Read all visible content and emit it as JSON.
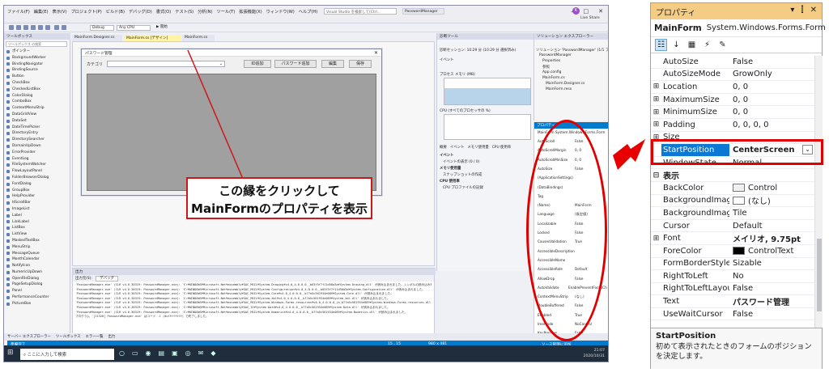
{
  "vs": {
    "menu": [
      "ファイル(F)",
      "編集(E)",
      "表示(V)",
      "プロジェクト(P)",
      "ビルド(B)",
      "デバッグ(D)",
      "書式(O)",
      "テスト(S)",
      "分析(N)",
      "ツール(T)",
      "拡張機能(X)",
      "ウィンドウ(W)",
      "ヘルプ(H)"
    ],
    "search_placeholder": "Visual Studio を検索して(Ctrl...",
    "project_name": "PasswordManager",
    "live_share": "Live Share",
    "toolbar_debug": "Debug",
    "toolbar_cpu": "Any CPU",
    "toolbar_start": "開始",
    "toolbox_title": "ツールボックス",
    "toolbox_search": "ツールボックス の検索",
    "toolbox_items": [
      "ポインター",
      "BackgroundWorker",
      "BindingNavigator",
      "BindingSource",
      "Button",
      "CheckBox",
      "CheckedListBox",
      "ColorDialog",
      "ComboBox",
      "ContextMenuStrip",
      "DataGridView",
      "DataSet",
      "DateTimePicker",
      "DirectoryEntry",
      "DirectorySearcher",
      "DomainUpDown",
      "ErrorProvider",
      "EventLog",
      "FileSystemWatcher",
      "FlowLayoutPanel",
      "FolderBrowserDialog",
      "FontDialog",
      "GroupBox",
      "HelpProvider",
      "HScrollBar",
      "ImageList",
      "Label",
      "LinkLabel",
      "ListBox",
      "ListView",
      "MaskedTextBox",
      "MenuStrip",
      "MessageQueue",
      "MonthCalendar",
      "NotifyIcon",
      "NumericUpDown",
      "OpenFileDialog",
      "PageSetupDialog",
      "Panel",
      "PerformanceCounter",
      "PictureBox"
    ],
    "doc_tabs": [
      "MainForm.Designer.cs",
      "MainForm.cs [デザイン]",
      "MainForm.cs"
    ],
    "form": {
      "title": "パスワード管理",
      "category_label": "カテゴリ",
      "buttons": [
        "ID追加",
        "パスワード追加",
        "編集",
        "保存"
      ]
    },
    "output_title": "出力",
    "output_source_label": "出力元(S):",
    "output_source": "デバッグ",
    "output_lines": [
      "'PasswordManager.exe' (CLR v4.0.30319: PasswordManager.exe): 'C:¥WINDOWS¥Microsoft.Net¥assembly¥GAC_MSIL¥System.Drawing¥v4.0_4.0.0.0__b03f5f7f11d50a3a¥System.Drawing.dll' が読み込まれました。シンボルの読み込みをスキップしました。",
      "'PasswordManager.exe' (CLR v4.0.30319: PasswordManager.exe): 'C:¥WINDOWS¥Microsoft.Net¥assembly¥GAC_MSIL¥System.Configuration¥v4.0_4.0.0.0__b03f5f7f11d50a3a¥System.Configuration.dll' が読み込まれました。",
      "'PasswordManager.exe' (CLR v4.0.30319: PasswordManager.exe): 'C:¥WINDOWS¥Microsoft.Net¥assembly¥GAC_MSIL¥System.Core¥v4.0_4.0.0.0__b77a5c561934e089¥System.Core.dll' が読み込まれました。",
      "'PasswordManager.exe' (CLR v4.0.30319: PasswordManager.exe): 'C:¥WINDOWS¥Microsoft.Net¥assembly¥GAC_MSIL¥System.Xml¥v4.0_4.0.0.0__b77a5c561934e089¥System.Xml.dll' が読み込まれました。",
      "'PasswordManager.exe' (CLR v4.0.30319: PasswordManager.exe): 'C:¥WINDOWS¥Microsoft.Net¥assembly¥GAC_MSIL¥System.Windows.Forms.resources¥v4.0_4.0.0.0_ja_b77a5c561934e089¥System.Windows.Forms.resources.dll' が読み込まれました。",
      "'PasswordManager.exe' (CLR v4.0.30319: PasswordManager.exe): 'C:¥WINDOWS¥Microsoft.Net¥assembly¥GAC_32¥System.Data¥v4.0_4.0.0.0__b77a5c561934e089¥System.Data.dll' が読み込まれました。",
      "'PasswordManager.exe' (CLR v4.0.30319: PasswordManager.exe): 'C:¥WINDOWS¥Microsoft.Net¥assembly¥GAC_MSIL¥System.Numerics¥v4.0_4.0.0.0__b77a5c561934e089¥System.Numerics.dll' が読み込まれました。",
      "プログラム '[11320] PasswordManager.exe' はコード -1 (0xffffffff) で終了しました。"
    ],
    "diag_title": "診断ツール",
    "diag_session": "診断セッション: 10:29 分 (10:29 分 選択済み)",
    "diag_events": "イベント",
    "diag_memory": "プロセス メモリ (MB)",
    "diag_cpu": "CPU (すべてのプロセッサの %)",
    "diag_summary_tabs": [
      "概要",
      "イベント",
      "メモリ使用量",
      "CPU 使用率"
    ],
    "diag_summary_items": [
      "イベント",
      "イベントの表示 (0 / 0)",
      "メモリ使用量",
      "スナップショットの作成",
      "CPU 使用率",
      "CPU プロファイルの記録"
    ],
    "solution_title": "ソリューション エクスプローラー",
    "solution_items": [
      "ソリューション 'PasswordManager' (1/1 プロジェクト)",
      "PasswordManager",
      "Properties",
      "参照",
      "App.config",
      "MainForm.cs",
      "MainForm.Designer.cs",
      "MainForm.resx"
    ],
    "small_props_title": "プロパティ",
    "small_props_obj": "MainForm  System.Windows.Forms.Form",
    "small_props_rows": [
      [
        "AutoScroll",
        "False"
      ],
      [
        "AutoScrollMargin",
        "0, 0"
      ],
      [
        "AutoScrollMinSize",
        "0, 0"
      ],
      [
        "AutoSize",
        "False"
      ],
      [
        "(ApplicationSettings)",
        ""
      ],
      [
        "(DataBindings)",
        ""
      ],
      [
        "Tag",
        ""
      ],
      [
        "(Name)",
        "MainForm"
      ],
      [
        "Language",
        "(既定値)"
      ],
      [
        "Localizable",
        "False"
      ],
      [
        "Locked",
        "False"
      ],
      [
        "CausesValidation",
        "True"
      ],
      [
        "AccessibleDescription",
        ""
      ],
      [
        "AccessibleName",
        ""
      ],
      [
        "AccessibleRole",
        "Default"
      ],
      [
        "AllowDrop",
        "False"
      ],
      [
        "AutoValidate",
        "EnablePreventFocusChange"
      ],
      [
        "ContextMenuStrip",
        "(なし)"
      ],
      [
        "DoubleBuffered",
        "False"
      ],
      [
        "Enabled",
        "True"
      ],
      [
        "ImeMode",
        "NoControl"
      ],
      [
        "KeyPreview",
        "False"
      ],
      [
        "ImeMode",
        "NoControl"
      ]
    ],
    "bottom_tabs": [
      "サーバー エクスプローラー",
      "ツールボックス",
      "エラー一覧",
      "出力"
    ],
    "status_left": "準備完了",
    "status_pos": "15 , 15",
    "status_size": "980 x 481",
    "status_right": "ソース管理に追加",
    "taskbar_search": "ここに入力して検索",
    "clock_time": "21:07",
    "clock_date": "2020/10/31"
  },
  "callout": {
    "line1": "この縁をクリックして",
    "line2": "MainFormのプロパティを表示"
  },
  "panel": {
    "title": "プロパティ",
    "object_name": "MainForm",
    "object_type": "System.Windows.Forms.Form",
    "rows": [
      {
        "name": "AutoSize",
        "value": "False",
        "kind": "prop"
      },
      {
        "name": "AutoSizeMode",
        "value": "GrowOnly",
        "kind": "prop"
      },
      {
        "name": "Location",
        "value": "0, 0",
        "kind": "prop",
        "expand": "⊞"
      },
      {
        "name": "MaximumSize",
        "value": "0, 0",
        "kind": "prop",
        "expand": "⊞"
      },
      {
        "name": "MinimumSize",
        "value": "0, 0",
        "kind": "prop",
        "expand": "⊞"
      },
      {
        "name": "Padding",
        "value": "0, 0, 0, 0",
        "kind": "prop",
        "expand": "⊞"
      },
      {
        "name": "Size",
        "value": "",
        "kind": "prop",
        "expand": "⊞"
      },
      {
        "name": "StartPosition",
        "value": "CenterScreen",
        "kind": "selected"
      },
      {
        "name": "WindowState",
        "value": "Normal",
        "kind": "prop"
      },
      {
        "name": "表示",
        "value": "",
        "kind": "category",
        "expand": "⊟"
      },
      {
        "name": "BackColor",
        "value": "Control",
        "kind": "color",
        "swatch": "#f0f0f0"
      },
      {
        "name": "BackgroundImage",
        "value": "(なし)",
        "kind": "color",
        "swatch": "#ffffff"
      },
      {
        "name": "BackgroundImageLayout",
        "value": "Tile",
        "kind": "prop"
      },
      {
        "name": "Cursor",
        "value": "Default",
        "kind": "prop"
      },
      {
        "name": "Font",
        "value": "メイリオ, 9.75pt",
        "kind": "bold",
        "expand": "⊞"
      },
      {
        "name": "ForeColor",
        "value": "ControlText",
        "kind": "color",
        "swatch": "#000000"
      },
      {
        "name": "FormBorderStyle",
        "value": "Sizable",
        "kind": "prop"
      },
      {
        "name": "RightToLeft",
        "value": "No",
        "kind": "prop"
      },
      {
        "name": "RightToLeftLayout",
        "value": "False",
        "kind": "prop"
      },
      {
        "name": "Text",
        "value": "パスワード管理",
        "kind": "bold"
      },
      {
        "name": "UseWaitCursor",
        "value": "False",
        "kind": "prop"
      }
    ],
    "desc_title": "StartPosition",
    "desc_text": "初めて表示されたときのフォームのポジションを決定します。"
  },
  "colors": {
    "accent": "#007acc",
    "highlight_red": "#e00000",
    "panel_title": "#f5cc84",
    "selected_row": "#0b78d4"
  }
}
